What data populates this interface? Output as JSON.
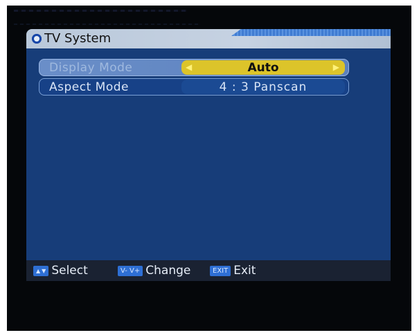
{
  "menu": {
    "title": "TV System",
    "rows": [
      {
        "label": "Display Mode",
        "value": "Auto",
        "selected": true
      },
      {
        "label": "Aspect Mode",
        "value": "4 : 3 Panscan",
        "selected": false
      }
    ]
  },
  "footer": {
    "select_label": "Select",
    "change_key": "V- V+",
    "change_label": "Change",
    "exit_key": "EXIT",
    "exit_label": "Exit"
  },
  "colors": {
    "panel": "#173d79",
    "selected_value": "#dcc42a",
    "title_bar": "#c6d2e2"
  }
}
